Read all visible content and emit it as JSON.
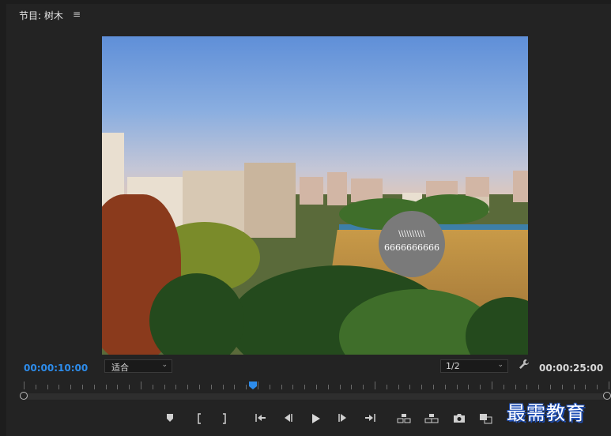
{
  "panel": {
    "title_prefix": "节目:",
    "sequence_name": "树木",
    "menu_icon": "hamburger-menu-icon"
  },
  "overlay": {
    "top_text": "\\\\\\\\\\\\\\\\\\\\",
    "bottom_text": "6666666666"
  },
  "controls": {
    "current_time": "00:00:10:00",
    "fit_label": "适合",
    "resolution_label": "1/2",
    "duration": "00:00:25:00",
    "settings_icon": "wrench-icon"
  },
  "transport": [
    {
      "name": "add-marker-button",
      "icon": "marker-icon"
    },
    {
      "name": "mark-in-button",
      "icon": "mark-in-icon"
    },
    {
      "name": "mark-out-button",
      "icon": "mark-out-icon"
    },
    {
      "name": "go-to-in-button",
      "icon": "go-to-in-icon"
    },
    {
      "name": "step-back-button",
      "icon": "step-back-icon"
    },
    {
      "name": "play-button",
      "icon": "play-icon"
    },
    {
      "name": "step-forward-button",
      "icon": "step-forward-icon"
    },
    {
      "name": "go-to-out-button",
      "icon": "go-to-out-icon"
    },
    {
      "name": "lift-button",
      "icon": "lift-icon"
    },
    {
      "name": "extract-button",
      "icon": "extract-icon"
    },
    {
      "name": "export-frame-button",
      "icon": "camera-icon"
    },
    {
      "name": "compare-view-button",
      "icon": "compare-icon"
    }
  ],
  "watermark": "最需教育",
  "colors": {
    "accent": "#2d8ceb",
    "panel_bg": "#232323",
    "overlay_circle": "#7a7a7a"
  }
}
